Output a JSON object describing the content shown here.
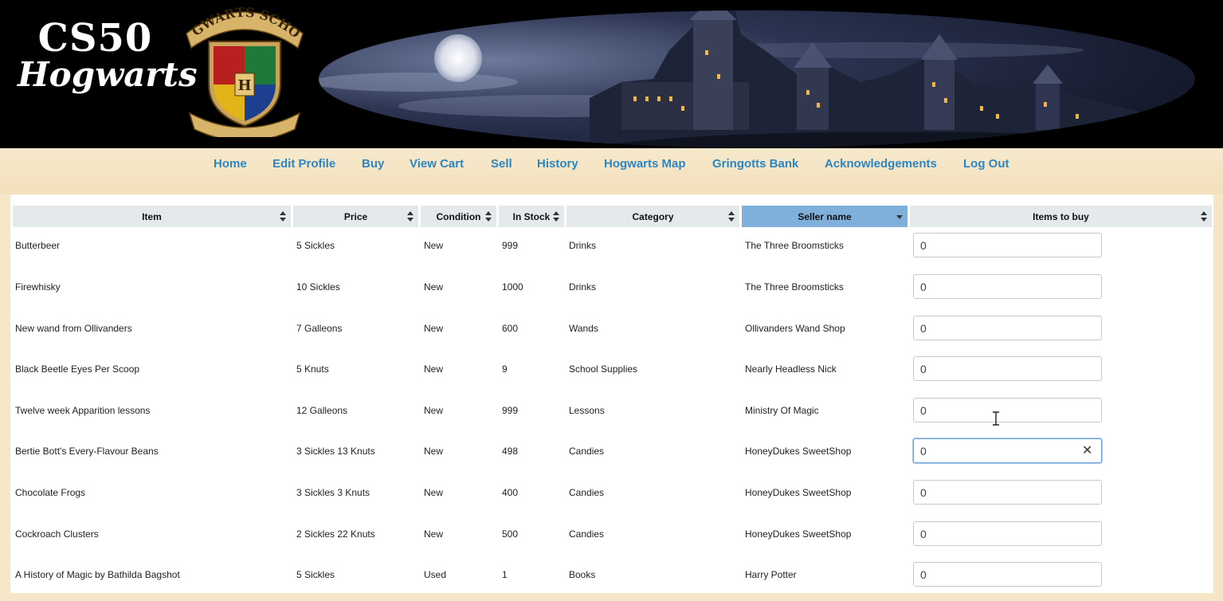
{
  "brand": {
    "line1": "CS50",
    "line2": "Hogwarts"
  },
  "crest": {
    "text": "HOGWARTS SCHOOL",
    "letter": "H"
  },
  "nav": [
    {
      "label": "Home"
    },
    {
      "label": "Edit Profile"
    },
    {
      "label": "Buy"
    },
    {
      "label": "View Cart"
    },
    {
      "label": "Sell"
    },
    {
      "label": "History"
    },
    {
      "label": "Hogwarts Map"
    },
    {
      "label": "Gringotts Bank"
    },
    {
      "label": "Acknowledgements"
    },
    {
      "label": "Log Out"
    }
  ],
  "table": {
    "headers": [
      "Item",
      "Price",
      "Condition",
      "In Stock",
      "Category",
      "Seller name",
      "Items to buy"
    ],
    "sorted_column": "Seller name",
    "rows": [
      {
        "item": "Butterbeer",
        "price": "5 Sickles",
        "condition": "New",
        "stock": "999",
        "category": "Drinks",
        "seller": "The Three Broomsticks",
        "qty": "0"
      },
      {
        "item": "Firewhisky",
        "price": "10 Sickles",
        "condition": "New",
        "stock": "1000",
        "category": "Drinks",
        "seller": "The Three Broomsticks",
        "qty": "0"
      },
      {
        "item": "New wand from Ollivanders",
        "price": "7 Galleons",
        "condition": "New",
        "stock": "600",
        "category": "Wands",
        "seller": "Ollivanders Wand Shop",
        "qty": "0"
      },
      {
        "item": "Black Beetle Eyes Per Scoop",
        "price": "5 Knuts",
        "condition": "New",
        "stock": "9",
        "category": "School Supplies",
        "seller": "Nearly Headless Nick",
        "qty": "0"
      },
      {
        "item": "Twelve week Apparition lessons",
        "price": "12 Galleons",
        "condition": "New",
        "stock": "999",
        "category": "Lessons",
        "seller": "Ministry Of Magic",
        "qty": "0"
      },
      {
        "item": "Bertie Bott's Every-Flavour Beans",
        "price": "3 Sickles 13 Knuts",
        "condition": "New",
        "stock": "498",
        "category": "Candies",
        "seller": "HoneyDukes SweetShop",
        "qty": "0"
      },
      {
        "item": "Chocolate Frogs",
        "price": "3 Sickles 3 Knuts",
        "condition": "New",
        "stock": "400",
        "category": "Candies",
        "seller": "HoneyDukes SweetShop",
        "qty": "0"
      },
      {
        "item": "Cockroach Clusters",
        "price": "2 Sickles 22 Knuts",
        "condition": "New",
        "stock": "500",
        "category": "Candies",
        "seller": "HoneyDukes SweetShop",
        "qty": "0"
      },
      {
        "item": "A History of Magic by Bathilda Bagshot",
        "price": "5 Sickles",
        "condition": "Used",
        "stock": "1",
        "category": "Books",
        "seller": "Harry Potter",
        "qty": "0"
      }
    ],
    "focused_row": 5,
    "clear_glyph": "✕"
  },
  "colors": {
    "link": "#2b86c3",
    "header_bg": "#e4eaec",
    "active_header_bg": "#7fb0dc",
    "page_bg": "#f6e6c8"
  }
}
